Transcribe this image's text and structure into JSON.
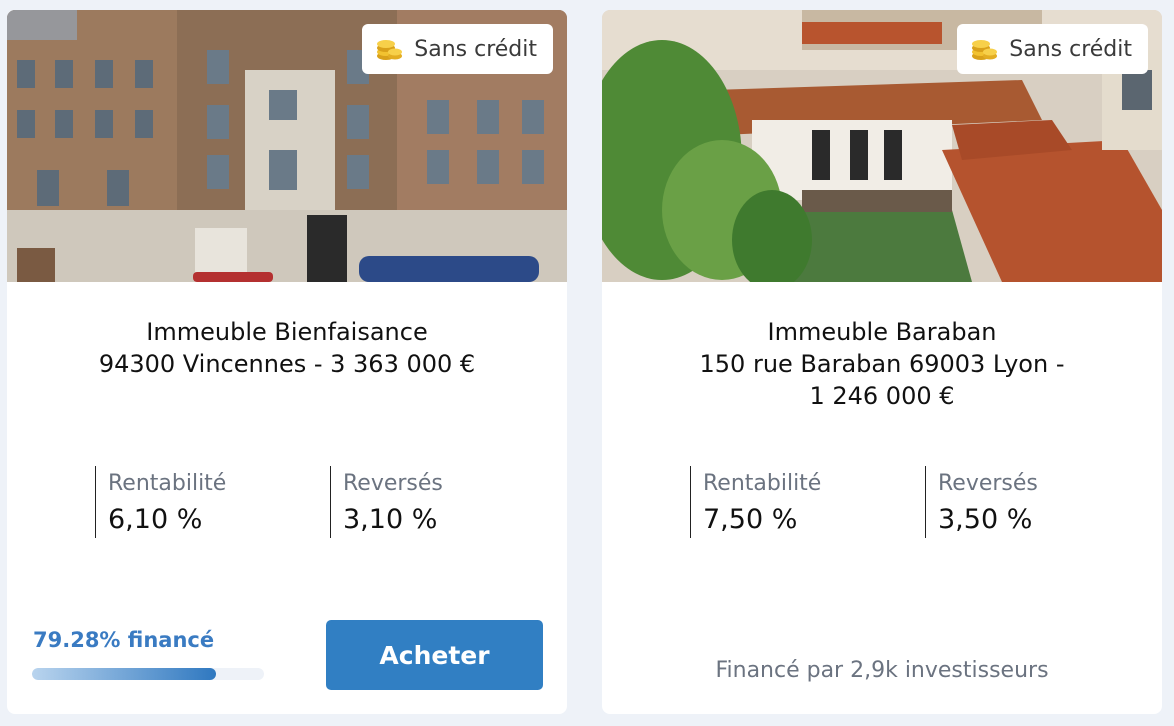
{
  "cards": [
    {
      "badge": {
        "label": "Sans crédit",
        "icon": "coins-icon"
      },
      "title_line1": "Immeuble Bienfaisance",
      "title_line2": "94300 Vincennes - 3 363 000 €",
      "stats": [
        {
          "label": "Rentabilité",
          "value": "6,10 %"
        },
        {
          "label": "Reversés",
          "value": "3,10 %"
        }
      ],
      "progress": {
        "label": "79.28% financé",
        "fraction": 0.7928
      },
      "buy_label": "Acheter"
    },
    {
      "badge": {
        "label": "Sans crédit",
        "icon": "coins-icon"
      },
      "title_line1": "Immeuble Baraban",
      "title_line2": "150 rue Baraban 69003 Lyon -",
      "title_line3": "1 246 000 €",
      "stats": [
        {
          "label": "Rentabilité",
          "value": "7,50 %"
        },
        {
          "label": "Reversés",
          "value": "3,50 %"
        }
      ],
      "investors": "Financé par 2,9k investisseurs"
    }
  ],
  "colors": {
    "page_background": "#eef2f8",
    "accent": "#317fc3",
    "progress_label": "#3a7bc2",
    "muted_text": "#6b7380"
  }
}
